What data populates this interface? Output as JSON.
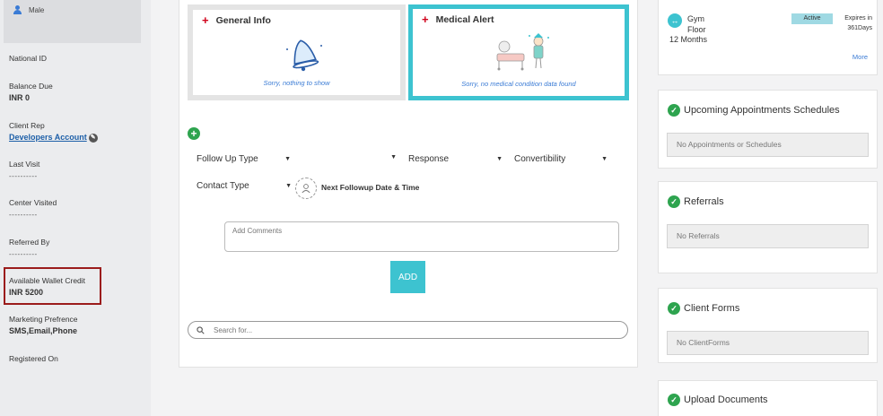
{
  "profile": {
    "gender": "Male"
  },
  "sidebar_fields": {
    "national_id_label": "National ID",
    "balance_due_label": "Balance Due",
    "balance_due_value": "INR 0",
    "client_rep_label": "Client Rep",
    "client_rep_value": "Developers Account",
    "last_visit_label": "Last Visit",
    "last_visit_value": "----------",
    "center_visited_label": "Center Visited",
    "center_visited_value": "----------",
    "referred_by_label": "Referred By",
    "referred_by_value": "----------",
    "wallet_label": "Available Wallet Credit",
    "wallet_value": "INR 5200",
    "marketing_label": "Marketing Prefrence",
    "marketing_value": "SMS,Email,Phone",
    "registered_label": "Registered On"
  },
  "cards": {
    "general_title": "General Info",
    "general_msg": "Sorry, nothing to show",
    "medical_title": "Medical Alert",
    "medical_msg": "Sorry, no medical condition data found"
  },
  "followup": {
    "followup_type": "Follow Up Type",
    "response": "Response",
    "convertibility": "Convertibility",
    "contact_type": "Contact Type",
    "next_followup": "Next Followup Date & Time",
    "comments_placeholder": "Add Comments",
    "add_label": "ADD",
    "search_placeholder": "Search for..."
  },
  "membership": {
    "name_line1": "Gym",
    "name_line2": "Floor",
    "duration": "12 Months",
    "status": "Active",
    "expires_line1": "Expires in",
    "expires_line2": "361Days",
    "more": "More"
  },
  "right_sections": {
    "appointments_title": "Upcoming Appointments Schedules",
    "appointments_empty": "No Appointments or Schedules",
    "referrals_title": "Referrals",
    "referrals_empty": "No Referrals",
    "forms_title": "Client Forms",
    "forms_empty": "No ClientForms",
    "upload_title": "Upload Documents"
  },
  "colors": {
    "accent_teal": "#3dc3d0",
    "success_green": "#2ea44f",
    "highlight_red": "#9b1c1c",
    "link_blue": "#1d5fa8"
  }
}
